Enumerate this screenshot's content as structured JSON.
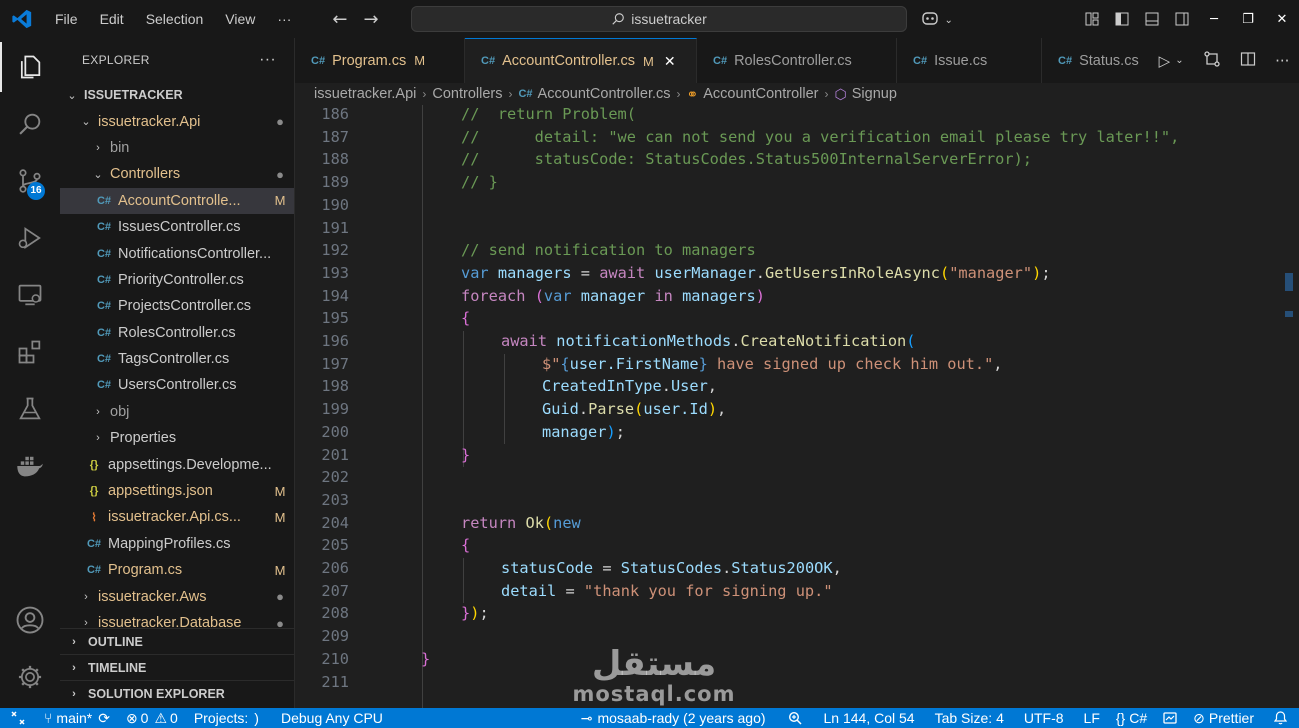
{
  "titlebar": {
    "menu": [
      "File",
      "Edit",
      "Selection",
      "View",
      "···"
    ],
    "search_text": "issuetracker"
  },
  "activity": {
    "scm_badge": "16"
  },
  "sidebar": {
    "title": "EXPLORER",
    "more": "···",
    "root": "ISSUETRACKER",
    "items": [
      {
        "label": "issuetracker.Api",
        "status": "●"
      },
      {
        "label": "bin",
        "status": ""
      },
      {
        "label": "Controllers",
        "status": "●"
      },
      {
        "label": "AccountControlle...",
        "status": "M"
      },
      {
        "label": "IssuesController.cs",
        "status": ""
      },
      {
        "label": "NotificationsController...",
        "status": ""
      },
      {
        "label": "PriorityController.cs",
        "status": ""
      },
      {
        "label": "ProjectsController.cs",
        "status": ""
      },
      {
        "label": "RolesController.cs",
        "status": ""
      },
      {
        "label": "TagsController.cs",
        "status": ""
      },
      {
        "label": "UsersController.cs",
        "status": ""
      },
      {
        "label": "obj",
        "status": ""
      },
      {
        "label": "Properties",
        "status": ""
      },
      {
        "label": "appsettings.Developme...",
        "status": ""
      },
      {
        "label": "appsettings.json",
        "status": "M"
      },
      {
        "label": "issuetracker.Api.cs...",
        "status": "M"
      },
      {
        "label": "MappingProfiles.cs",
        "status": ""
      },
      {
        "label": "Program.cs",
        "status": "M"
      },
      {
        "label": "issuetracker.Aws",
        "status": "●"
      },
      {
        "label": "issuetracker.Database",
        "status": "●"
      }
    ],
    "sections": [
      "OUTLINE",
      "TIMELINE",
      "SOLUTION EXPLORER"
    ]
  },
  "tabs": [
    {
      "label": "Program.cs",
      "mod": "M"
    },
    {
      "label": "AccountController.cs",
      "mod": "M"
    },
    {
      "label": "RolesController.cs",
      "mod": ""
    },
    {
      "label": "Issue.cs",
      "mod": ""
    },
    {
      "label": "Status.cs",
      "mod": ""
    }
  ],
  "breadcrumb": [
    "issuetracker.Api",
    "Controllers",
    "AccountController.cs",
    "AccountController",
    "Signup"
  ],
  "editor": {
    "line_numbers": [
      "186",
      "187",
      "188",
      "189",
      "190",
      "191",
      "192",
      "193",
      "194",
      "195",
      "196",
      "197",
      "198",
      "199",
      "200",
      "201",
      "202",
      "203",
      "204",
      "205",
      "206",
      "207",
      "208",
      "209",
      "210",
      "211"
    ],
    "lines": {
      "l186_a": "//  return Problem(",
      "l187_a": "//      detail: \"we can not send you a verification email please try later!!\",",
      "l188_a": "//      statusCode: StatusCodes.Status500InternalServerError);",
      "l189_a": "// }",
      "l192_a": "// send notification to managers",
      "l193_var": "var",
      "l193_name": "managers",
      "l193_eq": " = ",
      "l193_await": "await",
      "l193_obj": "userManager",
      "l193_dot": ".",
      "l193_fn": "GetUsersInRoleAsync",
      "l193_p": "(",
      "l193_str": "\"manager\"",
      "l193_pe": ")",
      "l193_semi": ";",
      "l194_kw": "foreach",
      "l194_p": "(",
      "l194_var": "var",
      "l194_name": "manager",
      "l194_in": "in",
      "l194_coll": "managers",
      "l194_pe": ")",
      "l195": "{",
      "l196_await": "await",
      "l196_obj": "notificationMethods",
      "l196_dot": ".",
      "l196_fn": "CreateNotification",
      "l196_p": "(",
      "l197_s1": "$\"",
      "l197_b1": "{",
      "l197_v": "user.FirstName",
      "l197_b2": "}",
      "l197_s2": " have signed up check him out.\"",
      "l197_c": ",",
      "l198_ty": "CreatedInType",
      "l198_dot": ".",
      "l198_v": "User",
      "l198_c": ",",
      "l199_ty": "Guid",
      "l199_dot": ".",
      "l199_fn": "Parse",
      "l199_p": "(",
      "l199_v": "user.Id",
      "l199_pe": ")",
      "l199_c": ",",
      "l200_v": "manager",
      "l200_pe": ")",
      "l200_semi": ";",
      "l201": "}",
      "l204_kw": "return",
      "l204_fn": "Ok",
      "l204_p": "(",
      "l204_new": "new",
      "l205": "{",
      "l206_v": "statusCode",
      "l206_eq": " = ",
      "l206_ty": "StatusCodes",
      "l206_dot": ".",
      "l206_m": "Status200OK",
      "l206_c": ",",
      "l207_v": "detail",
      "l207_eq": " = ",
      "l207_str": "\"thank you for signing up.\"",
      "l208_b": "}",
      "l208_p": ")",
      "l208_semi": ";",
      "l210": "}"
    }
  },
  "watermark": {
    "arabic": "مستقل",
    "latin": "mostaql.com"
  },
  "statusbar": {
    "branch": "main*",
    "errors": "0",
    "warnings": "0",
    "projects": "Projects: ",
    "projects_spinner": ")",
    "debug": "Debug Any CPU",
    "blame": "mosaab-rady (2 years ago)",
    "position": "Ln 144, Col 54",
    "tabsize": "Tab Size: 4",
    "encoding": "UTF-8",
    "eol": "LF",
    "language": "C#",
    "formatter": "Prettier"
  },
  "colors": {
    "accent": "#0078d4",
    "comment": "#6a9955",
    "keyword": "#569cd6",
    "control": "#c586c0",
    "string": "#ce9178"
  }
}
